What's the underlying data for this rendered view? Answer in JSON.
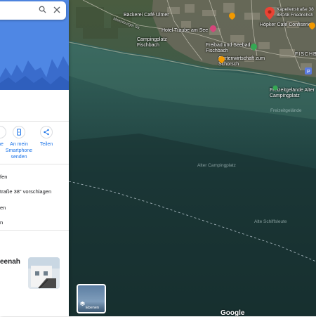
{
  "search": {
    "value": "",
    "search_icon": "search-icon",
    "close_icon": "close-icon"
  },
  "actions": [
    {
      "label": "ne",
      "icon": "bookmark-icon"
    },
    {
      "label": "An mein Smartphone senden",
      "icon": "phone-send-icon"
    },
    {
      "label": "Teilen",
      "icon": "share-icon"
    }
  ],
  "rows": {
    "row1": "fen",
    "row2": "traße 38\" vorschlagen",
    "row3": "en",
    "row4": "n"
  },
  "nearby": {
    "title": "eenah"
  },
  "map": {
    "pin_address_line1": "Kapellenstraße 38",
    "pin_address_line2": "88048 Friedrichsh",
    "poi": [
      "Bäckerei Café Ulmer",
      "Hotel Traube am See",
      "Höpker Café Confiserie",
      "Campingplatz Fischbach",
      "Freibad und Seebad Fischbach",
      "Gartenwirtschaft zum Schorsch",
      "Freizeitgelände Alter Campingplatz"
    ],
    "road_label": "Meersburger Str.",
    "district_label": "FISCHB",
    "faint_labels": [
      "Freizeitgelände",
      "Alter Campingplatz",
      "Alte Schiffsleute"
    ]
  },
  "layers_label": "Ebenen",
  "google_label": "Google",
  "colors": {
    "accent": "#1a73e8",
    "hero": "#4f87e4",
    "pin": "#ea4335",
    "poi_orange": "#f29900",
    "poi_pink": "#d6457b",
    "poi_green": "#34a853",
    "parking": "#5b7be0"
  }
}
